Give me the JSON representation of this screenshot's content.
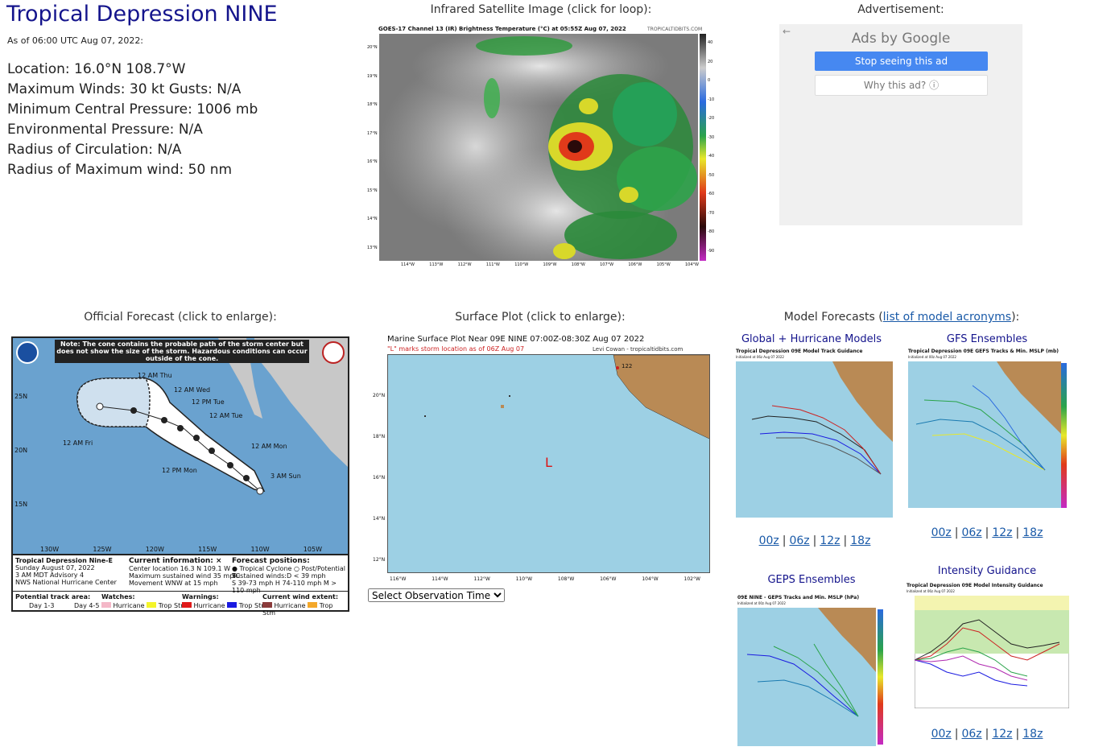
{
  "storm": {
    "title": "Tropical Depression NINE",
    "as_of": "As of 06:00 UTC Aug 07, 2022:",
    "location": "Location: 16.0°N 108.7°W",
    "winds": "Maximum Winds: 30 kt  Gusts: N/A",
    "pressure": "Minimum Central Pressure: 1006 mb",
    "env_pressure": "Environmental Pressure: N/A",
    "radius_circ": "Radius of Circulation: N/A",
    "radius_max": "Radius of Maximum wind: 50 nm"
  },
  "satellite": {
    "heading": "Infrared Satellite Image (click for loop):",
    "caption": "GOES-17 Channel 13 (IR) Brightness Temperature (°C) at 05:55Z Aug 07, 2022",
    "credit": "TROPICALTIDBITS.COM",
    "lat_labels": [
      "20°N",
      "19°N",
      "18°N",
      "17°N",
      "16°N",
      "15°N",
      "14°N",
      "13°N"
    ],
    "lon_labels": [
      "114°W",
      "113°W",
      "112°W",
      "111°W",
      "110°W",
      "109°W",
      "108°W",
      "107°W",
      "106°W",
      "105°W",
      "104°W"
    ],
    "scale_labels": [
      "40",
      "20",
      "0",
      "-10",
      "-20",
      "-30",
      "-40",
      "-50",
      "-60",
      "-70",
      "-80",
      "-90"
    ]
  },
  "ad": {
    "heading": "Advertisement:",
    "ads_by": "Ads by Google",
    "stop": "Stop seeing this ad",
    "why": "Why this ad? ⓘ"
  },
  "official": {
    "heading": "Official Forecast (click to enlarge):",
    "note": "Note: The cone contains the probable path of the storm center but does not show the size of the storm. Hazardous conditions can occur outside of the cone.",
    "lat_labels": [
      "25N",
      "20N",
      "15N"
    ],
    "lon_labels": [
      "130W",
      "125W",
      "120W",
      "115W",
      "110W",
      "105W"
    ],
    "points": [
      "12 AM Thu",
      "12 AM Wed",
      "12 PM Tue",
      "12 AM Tue",
      "12 AM Mon",
      "12 PM Mon",
      "12 AM Fri",
      "3 AM Sun"
    ],
    "storm_name": "Tropical Depression Nine-E",
    "date": "Sunday August 07, 2022",
    "advisory": "3 AM MDT Advisory 4",
    "center": "NWS National Hurricane Center",
    "cur_info": "Current information: ×",
    "cur_loc": "Center location 16.3 N 109.1 W",
    "cur_wind": "Maximum sustained wind 35 mph",
    "cur_move": "Movement WNW at 15 mph",
    "fcst_pos": "Forecast positions:",
    "fcst_tc": "Tropical Cyclone",
    "fcst_ptc": "Post/Potential TC",
    "sust": "Sustained winds:",
    "sust_d": "D < 39 mph",
    "sust_s": "S 39-73 mph  H 74-110 mph  M > 110 mph",
    "track_area": "Potential track area:",
    "day13": "Day 1-3",
    "day45": "Day 4-5",
    "watches": "Watches:",
    "w_hur": "Hurricane",
    "w_ts": "Trop Stm",
    "warnings": "Warnings:",
    "wn_hur": "Hurricane",
    "wn_ts": "Trop Stm",
    "wind_ext": "Current wind extent:",
    "we_hur": "Hurricane",
    "we_ts": "Trop Stm"
  },
  "surface": {
    "heading": "Surface Plot (click to enlarge):",
    "title": "Marine Surface Plot Near 09E NINE 07:00Z-08:30Z Aug 07 2022",
    "subtitle": "\"L\" marks storm location as of 06Z Aug 07",
    "credit": "Levi Cowan - tropicaltidbits.com",
    "marker": "L",
    "lat_labels": [
      "20°N",
      "18°N",
      "16°N",
      "14°N",
      "12°N"
    ],
    "lon_labels": [
      "116°W",
      "114°W",
      "112°W",
      "110°W",
      "108°W",
      "106°W",
      "104°W",
      "102°W"
    ],
    "obs": "122",
    "select": "Select Observation Time..."
  },
  "models": {
    "heading_prefix": "Model Forecasts (",
    "heading_link": "list of model acronyms",
    "heading_suffix": "):",
    "global_title": "Global + Hurricane Models",
    "gfs_title": "GFS Ensembles",
    "geps_title": "GEPS Ensembles",
    "intensity_title": "Intensity Guidance",
    "global_caption": "Tropical Depression 09E Model Track Guidance",
    "gfs_caption": "Tropical Depression 09E GEFS Tracks & Min. MSLP (mb)",
    "geps_caption": "09E NINE - GEPS Tracks and Min. MSLP (hPa)",
    "intensity_caption": "Tropical Depression 09E Model Intensity Guidance",
    "init06": "Initialized at 06z Aug 07 2022",
    "init00": "Initialized at 00z Aug 07 2022",
    "links_a": [
      "00z",
      "06z",
      "12z",
      "18z"
    ],
    "links_b": [
      "00z",
      "06z",
      "12z",
      "18z"
    ],
    "links_c": [
      "00z",
      "06z",
      "12z",
      "18z"
    ]
  },
  "colors": {
    "title": "#14148c",
    "ocean": "#9dd0e4",
    "land": "#b98a55",
    "google_blue": "#4688f1"
  }
}
